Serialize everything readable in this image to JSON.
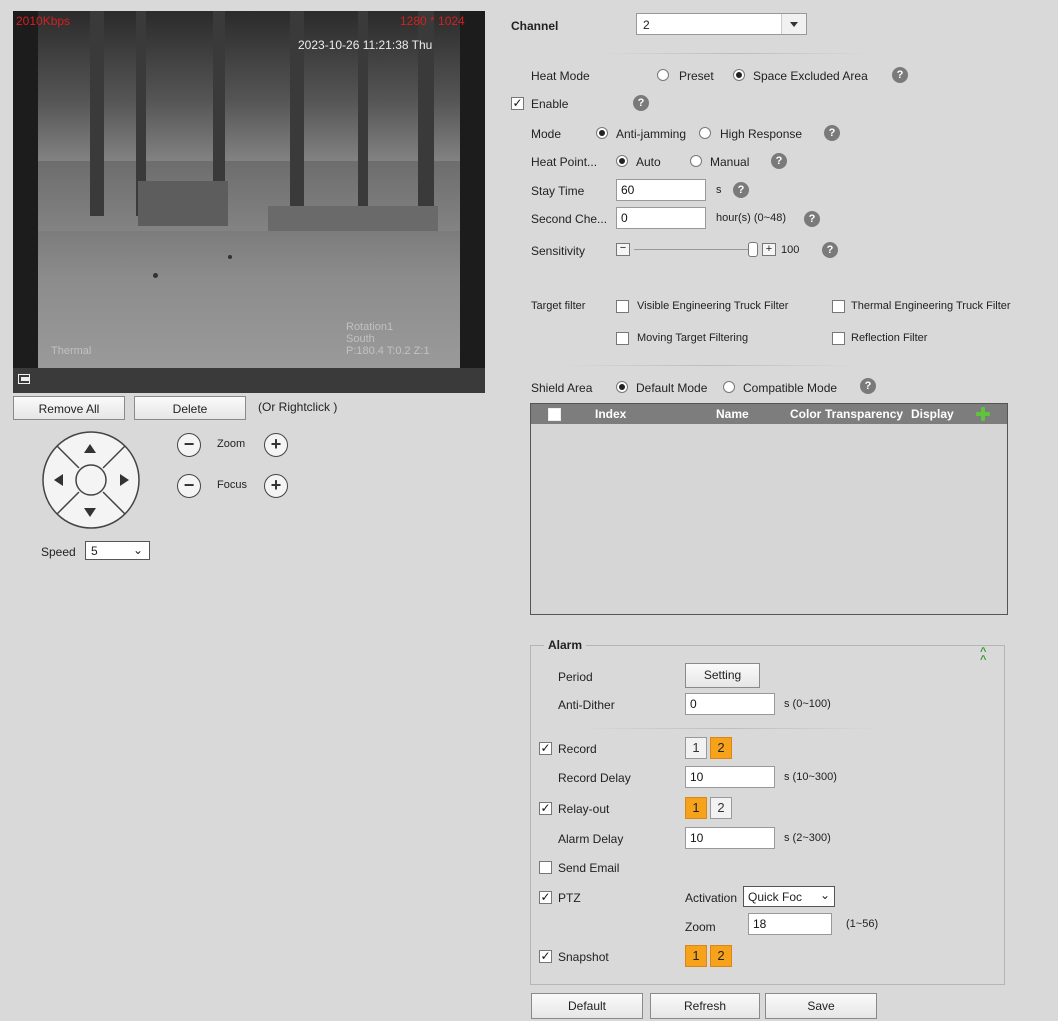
{
  "video": {
    "bitrate": "2010Kbps",
    "resolution": "1280 * 1024",
    "timestamp": "2023-10-26 11:21:38 Thu",
    "source_label": "Thermal",
    "osd_line1": "Rotation1",
    "osd_line2": "South",
    "osd_line3": "P:180.4 T:0.2 Z:1"
  },
  "area_buttons": {
    "remove_all": "Remove All",
    "delete": "Delete",
    "hint": "(Or Rightclick )"
  },
  "ptz": {
    "zoom_label": "Zoom",
    "focus_label": "Focus",
    "speed_label": "Speed",
    "speed_value": "5"
  },
  "form": {
    "channel_label": "Channel",
    "channel_value": "2",
    "heat_mode_label": "Heat Mode",
    "heat_mode_options": [
      "Preset",
      "Space Excluded Area"
    ],
    "enable_label": "Enable",
    "mode_label": "Mode",
    "mode_options": [
      "Anti-jamming",
      "High Response"
    ],
    "heat_point_label": "Heat Point...",
    "heat_point_options": [
      "Auto",
      "Manual"
    ],
    "stay_time_label": "Stay Time",
    "stay_time_value": "60",
    "stay_time_unit": "s",
    "second_check_label": "Second Che...",
    "second_check_value": "0",
    "second_check_unit": "hour(s) (0~48)",
    "sensitivity_label": "Sensitivity",
    "sensitivity_value": "100",
    "target_filter_label": "Target filter",
    "filters": [
      "Visible Engineering Truck Filter",
      "Thermal Engineering Truck Filter",
      "Moving Target Filtering",
      "Reflection Filter"
    ],
    "shield_area_label": "Shield Area",
    "shield_options": [
      "Default Mode",
      "Compatible Mode"
    ]
  },
  "table": {
    "columns": [
      "Index",
      "Name",
      "Color",
      "Transparency",
      "Display"
    ]
  },
  "alarm": {
    "title": "Alarm",
    "period_label": "Period",
    "setting_button": "Setting",
    "anti_dither_label": "Anti-Dither",
    "anti_dither_value": "0",
    "anti_dither_unit": "s (0~100)",
    "record_label": "Record",
    "record_delay_label": "Record Delay",
    "record_delay_value": "10",
    "record_delay_unit": "s (10~300)",
    "relay_label": "Relay-out",
    "alarm_delay_label": "Alarm Delay",
    "alarm_delay_value": "10",
    "alarm_delay_unit": "s (2~300)",
    "send_email_label": "Send Email",
    "ptz_label": "PTZ",
    "activation_label": "Activation",
    "activation_value": "Quick Foc",
    "zoom_label": "Zoom",
    "zoom_value": "18",
    "zoom_unit": "(1~56)",
    "snapshot_label": "Snapshot",
    "channel_numbers": [
      "1",
      "2"
    ]
  },
  "footer": {
    "default": "Default",
    "refresh": "Refresh",
    "save": "Save"
  },
  "colors": {
    "accent_orange": "#f7a21b",
    "table_header": "#7d7d7d",
    "osd_red": "#d42020"
  }
}
